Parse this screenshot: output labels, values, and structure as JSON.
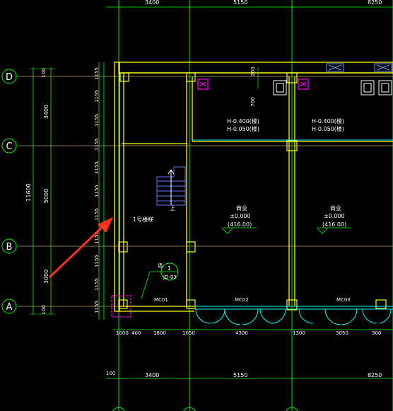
{
  "colors": {
    "background": "#000000",
    "wall": "#ffff00",
    "axis": "#00ff00",
    "dim": "#00ff00",
    "door": "#00ffff",
    "arrow": "#ff3020",
    "column_mark": "#ff00ff",
    "text": "#ffffff"
  },
  "grid_axes": {
    "rows": [
      "D",
      "C",
      "B",
      "A"
    ]
  },
  "dims": {
    "top": [
      "3400",
      "5150",
      "8250"
    ],
    "bottom_total": [
      "3400",
      "5150",
      "8250"
    ],
    "bottom_detail": [
      "1000",
      "400",
      "1800",
      "1050",
      "4300",
      "1300",
      "3050",
      "300"
    ],
    "bottom_extra": "100",
    "left_total": "11600",
    "left_segments": [
      "3400",
      "5000",
      "3000"
    ],
    "left_top_edge": "100",
    "left_bottom_edge": "100",
    "left_small": [
      "1155",
      "1155",
      "1155",
      "1155",
      "1155",
      "1155",
      "1155",
      "1155",
      "1155",
      "1155",
      "1155",
      "1155"
    ],
    "top_mid": "200",
    "side_mid": "700"
  },
  "annotations": {
    "elev_upper_1": "H-0.400(楼)",
    "elev_upper_2": "H-0.050(楼)",
    "elev_upper_3": "H-0.400(楼)",
    "elev_upper_4": "H-0.050(楼)",
    "shop1_label": "商业",
    "shop1_level": "±0.000",
    "shop1_abs": "(416.00)",
    "shop2_label": "商业",
    "shop2_level": "±0.000",
    "shop2_abs": "(416.00)",
    "stair_name": "1号楼梯",
    "stair_up": "上",
    "detail_num": "1",
    "detail_ref": "JD-03",
    "detail_tag": "墙",
    "door1": "MC01",
    "door2": "MC02",
    "door3": "MC03"
  }
}
